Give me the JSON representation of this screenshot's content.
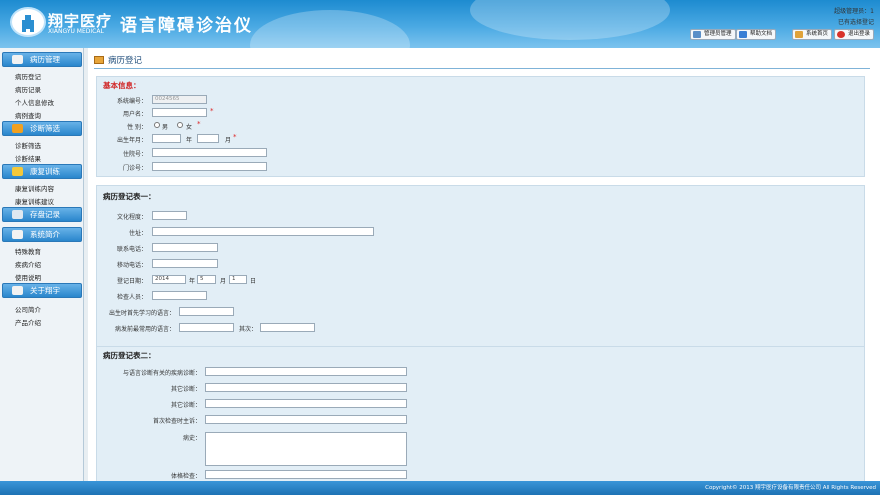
{
  "header": {
    "brand": "翔宇医疗",
    "brand_en": "XIANGYU MEDICAL",
    "product": "语言障碍诊治仪",
    "user_info": "超级管理员：1",
    "store_link": "已有选择登记",
    "buttons": [
      {
        "label": "管理员管理",
        "icon": "admin-icon",
        "color": "#5a8fc8"
      },
      {
        "label": "帮助文档",
        "icon": "help-icon",
        "color": "#3a7fd5"
      },
      {
        "label": "系统首页",
        "icon": "home-icon",
        "color": "#e0a23a"
      },
      {
        "label": "退出登录",
        "icon": "logout-icon",
        "color": "#d8322a"
      }
    ]
  },
  "sidebar": {
    "sections": [
      {
        "title": "病历管理",
        "icon": "document-icon",
        "color": "#f2f2f2",
        "items": [
          "病历登记",
          "病历记录",
          "个人信息修改",
          "病例查询"
        ]
      },
      {
        "title": "诊断筛选",
        "icon": "screening-icon",
        "color": "#f0a020",
        "items": [
          "诊断筛选",
          "诊断结果"
        ]
      },
      {
        "title": "康复训练",
        "icon": "training-icon",
        "color": "#f3c83a",
        "items": [
          "康复训练内容",
          "康复训练建议"
        ]
      },
      {
        "title": "存盘记录",
        "icon": "save-record-icon",
        "color": "#dfe8f0",
        "items": []
      },
      {
        "title": "系统简介",
        "icon": "system-icon",
        "color": "#f2f2f2",
        "items": [
          "特殊教育",
          "疾病介绍",
          "使用说明"
        ]
      },
      {
        "title": "关于翔宇",
        "icon": "about-icon",
        "color": "#f2f2f2",
        "items": [
          "公司简介",
          "产品介绍"
        ]
      }
    ]
  },
  "page": {
    "title": "病历登记"
  },
  "basic": {
    "title": "基本信息：",
    "sysno_label": "系统编号：",
    "sysno_value": "0024565",
    "username_label": "用户名：",
    "gender_label": "性 别：",
    "male": "男",
    "female": "女",
    "birth_label": "出生年月：",
    "year": "年",
    "month": "月",
    "inpatient_label": "住院号：",
    "outpatient_label": "门诊号："
  },
  "form1": {
    "title": "病历登记表一：",
    "education_label": "文化程度：",
    "address_label": "住址：",
    "contact_label": "联系电话：",
    "mobile_label": "移动电话：",
    "regdate_label": "登记日期：",
    "regdate_year": "2014",
    "regdate_month": "5",
    "regdate_day": "1",
    "year": "年",
    "month": "月",
    "day": "日",
    "examiner_label": "检查人员：",
    "firstlang_label": "出生时首先学习的语言：",
    "uselang_label": "病发前最常用的语言：",
    "second_label": "其次："
  },
  "form2": {
    "title": "病历登记表二：",
    "diag_label": "与语言诊断有关的疾病诊断：",
    "other1_label": "其它诊断：",
    "other2_label": "其它诊断：",
    "complaint_label": "首次检查时主诉：",
    "history_label": "病史：",
    "physical_label": "体格检查："
  },
  "footer": {
    "copyright": "Copyright© 2013 翔宇医疗设备有限责任公司 All Rights Reserved"
  }
}
